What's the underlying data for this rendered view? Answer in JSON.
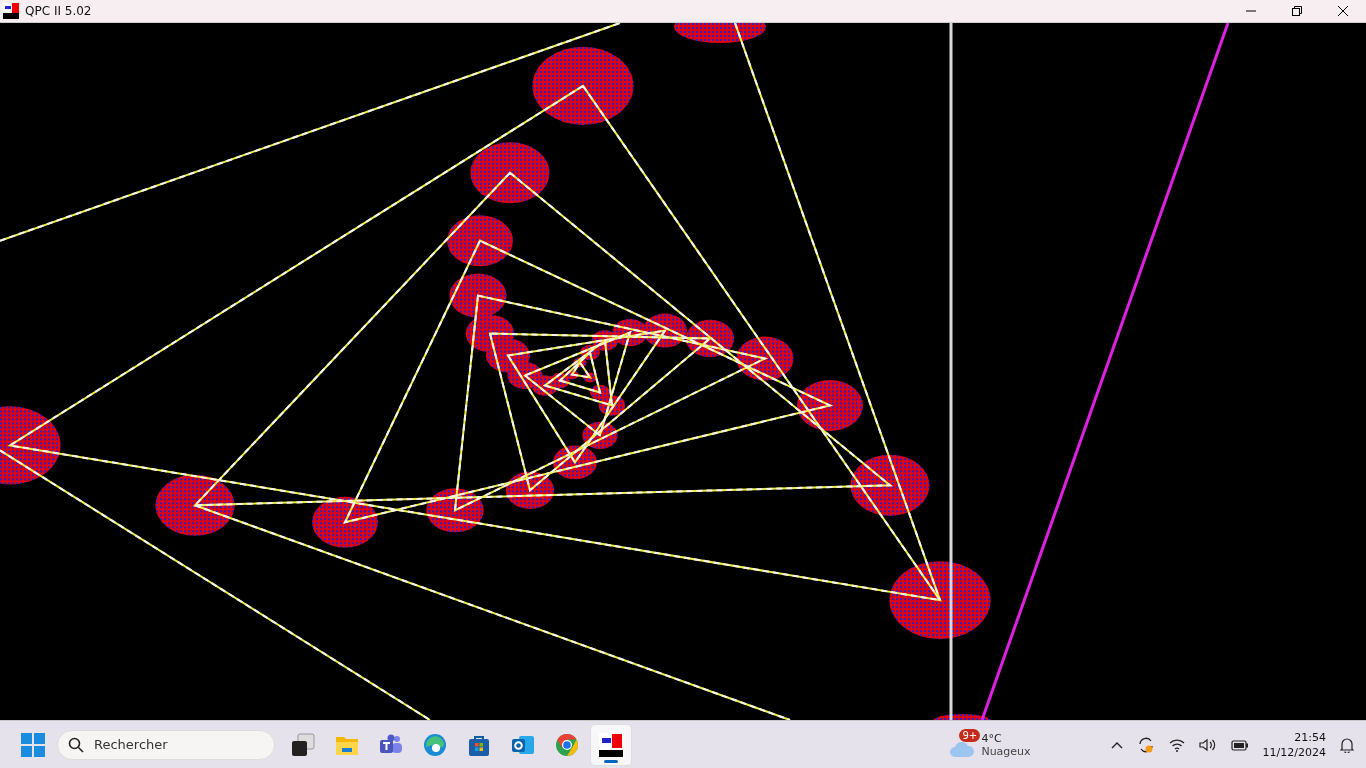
{
  "window": {
    "title": "QPC II 5.02"
  },
  "taskbar": {
    "search": {
      "placeholder": "Rechercher"
    },
    "apps": [
      {
        "kind": "taskview",
        "selected": false
      },
      {
        "kind": "files",
        "selected": false
      },
      {
        "kind": "teams",
        "selected": false
      },
      {
        "kind": "edge",
        "selected": false
      },
      {
        "kind": "store",
        "selected": false
      },
      {
        "kind": "outlook",
        "selected": false
      },
      {
        "kind": "chrome",
        "selected": false
      },
      {
        "kind": "qpc",
        "selected": true
      }
    ],
    "weather": {
      "badge": "9+",
      "temperature": "4°C",
      "condition": "Nuageux"
    },
    "clock": {
      "time": "21:54",
      "date": "11/12/2024"
    }
  }
}
